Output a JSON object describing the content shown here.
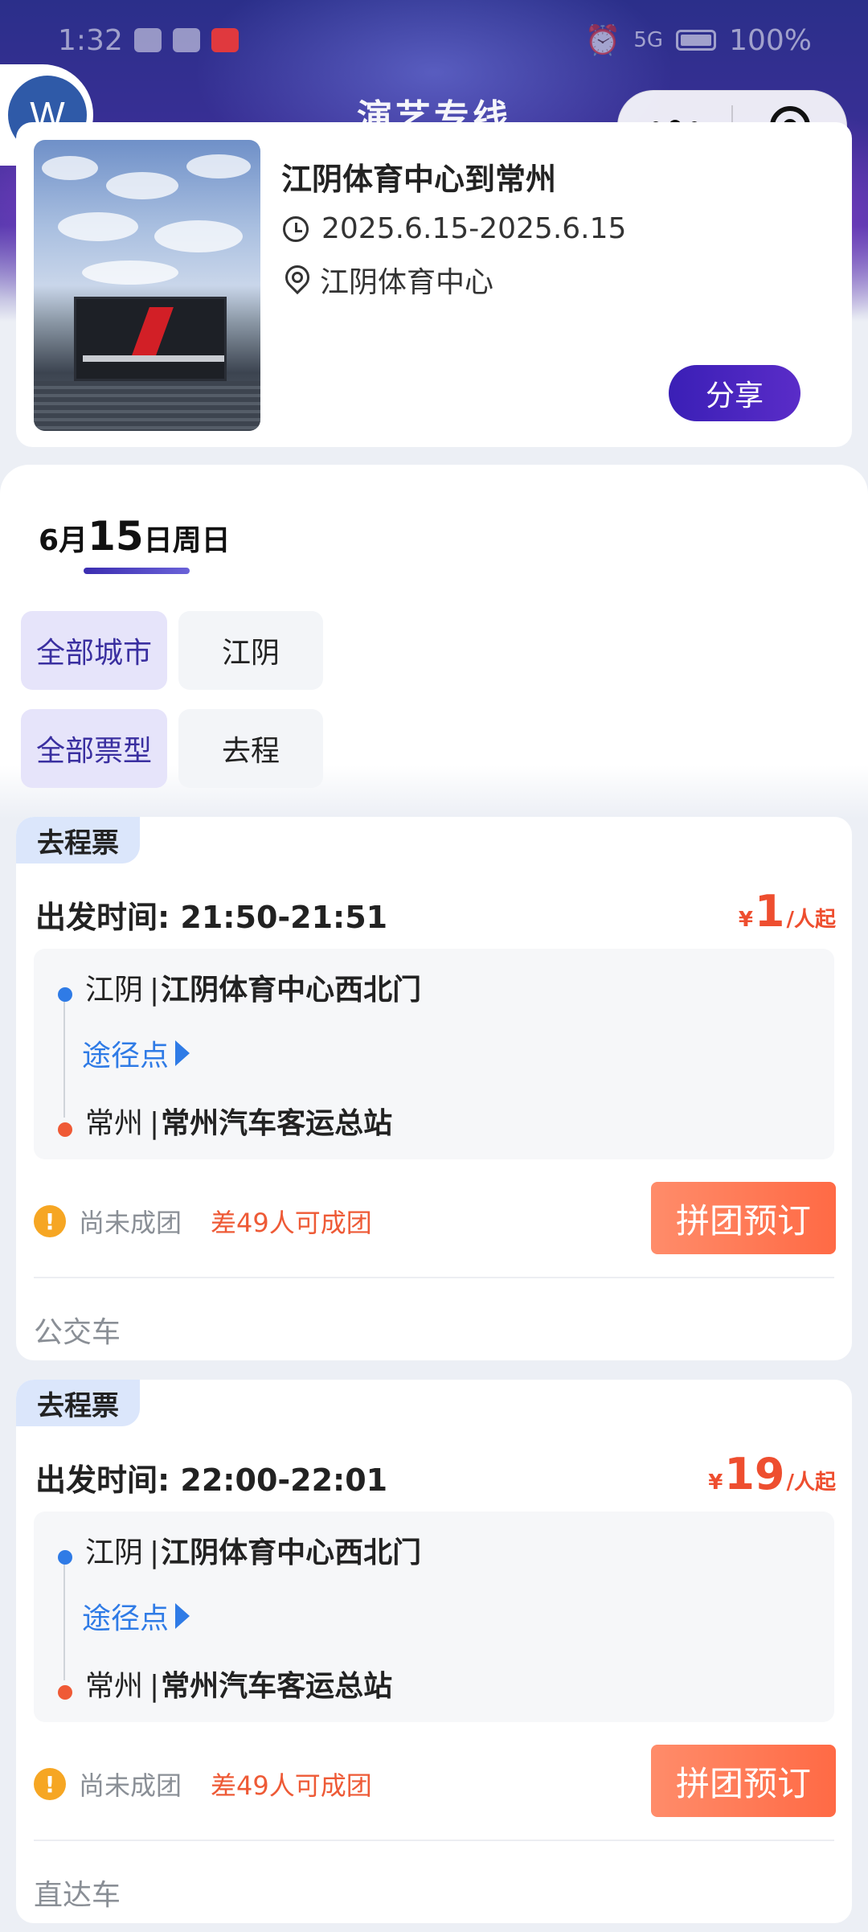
{
  "status_bar": {
    "time": "1:32",
    "network": "5G",
    "battery": "100%"
  },
  "page": {
    "title": "演艺专线"
  },
  "avatar": {
    "letter": "W",
    "color": "#2f5aa8"
  },
  "event": {
    "title": "江阴体育中心到常州",
    "date_range": "2025.6.15-2025.6.15",
    "venue": "江阴体育中心",
    "share_label": "分享",
    "image_icon": "stadium-photo"
  },
  "date_tab": {
    "month": "6月",
    "day": "15",
    "suffix": "日周日"
  },
  "filters": {
    "city": {
      "all_label": "全部城市",
      "option": "江阴"
    },
    "ticket_type": {
      "all_label": "全部票型",
      "option": "去程"
    }
  },
  "tickets": [
    {
      "tag": "去程票",
      "depart_label": "出发时间: 21:50-21:51",
      "price_currency": "¥",
      "price_value": "1",
      "price_unit": "/人起",
      "from_city": "江阴",
      "from_stop": "江阴体育中心西北门",
      "waypoint_label": "途径点",
      "to_city": "常州",
      "to_stop": "常州汽车客运总站",
      "status": "尚未成团",
      "need": "差49人可成团",
      "book_label": "拼团预订",
      "vehicle": "公交车"
    },
    {
      "tag": "去程票",
      "depart_label": "出发时间: 22:00-22:01",
      "price_currency": "¥",
      "price_value": "19",
      "price_unit": "/人起",
      "from_city": "江阴",
      "from_stop": "江阴体育中心西北门",
      "waypoint_label": "途径点",
      "to_city": "常州",
      "to_stop": "常州汽车客运总站",
      "status": "尚未成团",
      "need": "差49人可成团",
      "book_label": "拼团预订",
      "vehicle": "直达车"
    }
  ],
  "colors": {
    "accent": "#3a1fb6",
    "price": "#ee4e2f",
    "link": "#2f7be6",
    "book_button": "#ff6a45"
  }
}
